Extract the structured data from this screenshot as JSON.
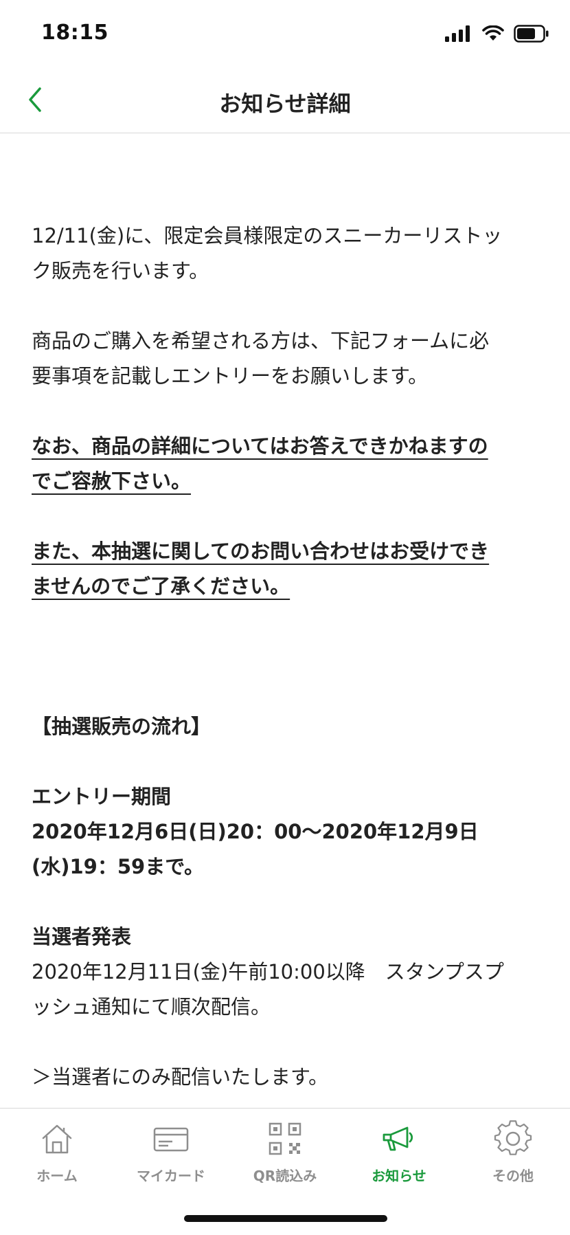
{
  "status_bar": {
    "time": "18:15"
  },
  "nav": {
    "title": "お知らせ詳細",
    "back_icon": "chevron-left-icon"
  },
  "content": {
    "para1": [
      "12/11(金)に、限定会員様限定のスニーカーリストッ",
      "ク販売を行います。"
    ],
    "para2": [
      "商品のご購入を希望される方は、下記フォームに必",
      "要事項を記載しエントリーをお願いします。"
    ],
    "note1": [
      "なお、商品の詳細についてはお答えできかねますの",
      "でご容赦下さい。"
    ],
    "note2": [
      "また、本抽選に関してのお問い合わせはお受けでき",
      "ませんのでご了承ください。"
    ],
    "section_heading": "【抽選販売の流れ】",
    "entry_label": "エントリー期間",
    "entry_period": [
      "2020年12月6日(日)20：00〜2020年12月9日",
      "(水)19：59まで。"
    ],
    "winner_label": "当選者発表",
    "winner_text": [
      "2020年12月11日(金)午前10:00以降　スタンプスプ",
      "ッシュ通知にて順次配信。"
    ],
    "winner_note": "＞当選者にのみ配信いたします。"
  },
  "tabs": [
    {
      "label": "ホーム",
      "icon": "home-icon",
      "active": false
    },
    {
      "label": "マイカード",
      "icon": "card-icon",
      "active": false
    },
    {
      "label": "QR読込み",
      "icon": "qr-code-icon",
      "active": false
    },
    {
      "label": "お知らせ",
      "icon": "megaphone-icon",
      "active": true
    },
    {
      "label": "その他",
      "icon": "gear-icon",
      "active": false
    }
  ],
  "colors": {
    "accent": "#1a9a3c",
    "inactive": "#8e8e8e",
    "text": "#222222",
    "divider": "#d8d8d8"
  }
}
